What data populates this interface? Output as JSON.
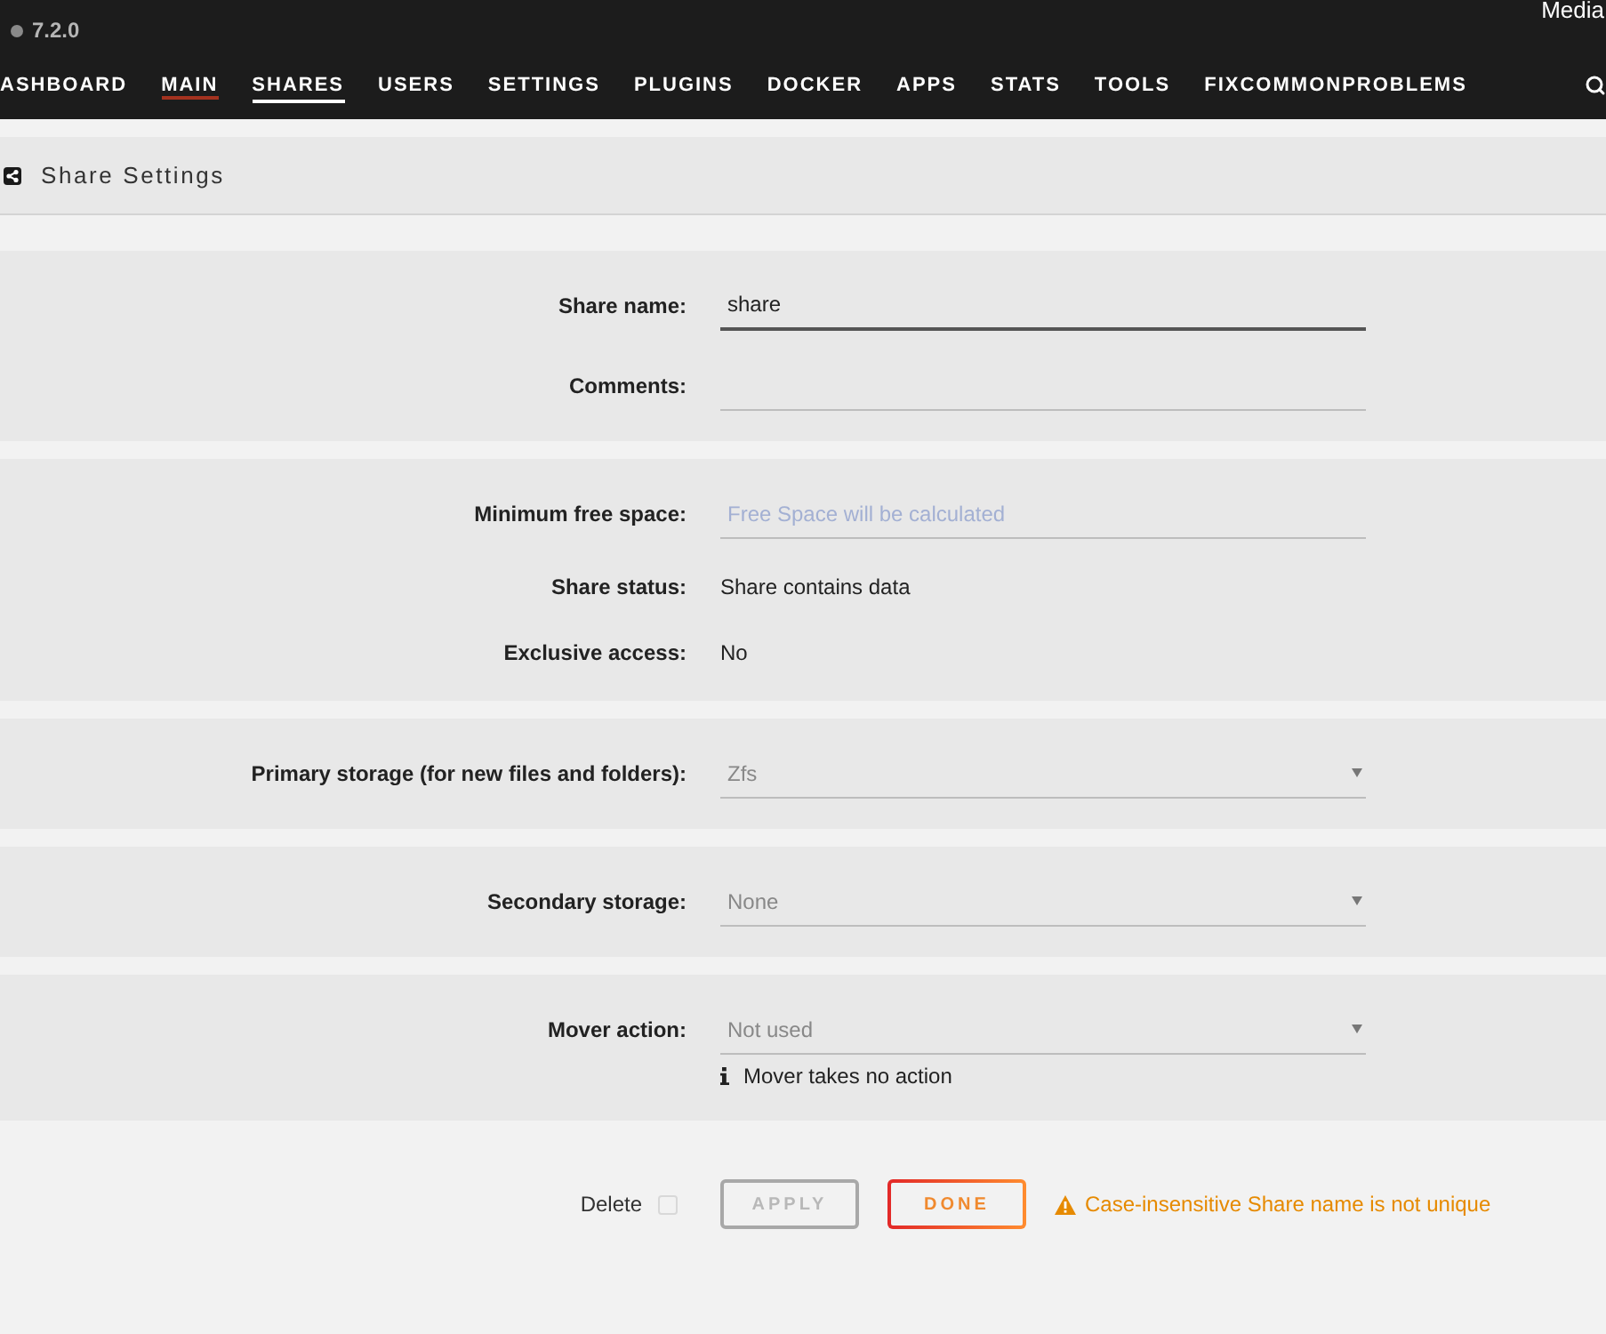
{
  "header": {
    "version": "7.2.0",
    "server_name": "Media"
  },
  "nav": {
    "items": [
      {
        "label": "ASHBOARD",
        "selected": false,
        "highlighted": false
      },
      {
        "label": "MAIN",
        "selected": false,
        "highlighted": true
      },
      {
        "label": "SHARES",
        "selected": true,
        "highlighted": false
      },
      {
        "label": "USERS",
        "selected": false,
        "highlighted": false
      },
      {
        "label": "SETTINGS",
        "selected": false,
        "highlighted": false
      },
      {
        "label": "PLUGINS",
        "selected": false,
        "highlighted": false
      },
      {
        "label": "DOCKER",
        "selected": false,
        "highlighted": false
      },
      {
        "label": "APPS",
        "selected": false,
        "highlighted": false
      },
      {
        "label": "STATS",
        "selected": false,
        "highlighted": false
      },
      {
        "label": "TOOLS",
        "selected": false,
        "highlighted": false
      },
      {
        "label": "FIXCOMMONPROBLEMS",
        "selected": false,
        "highlighted": false
      }
    ]
  },
  "page_title": "Share Settings",
  "sections": [
    {
      "rows": [
        {
          "kind": "input",
          "label": "Share name:",
          "value": "share",
          "focused": true
        },
        {
          "kind": "input",
          "label": "Comments:",
          "focused": false
        }
      ]
    },
    {
      "rows": [
        {
          "kind": "input",
          "label": "Minimum free space:",
          "placeholder": "Free Space will be calculated",
          "focused": false
        },
        {
          "kind": "text",
          "label": "Share status:",
          "value": "Share contains data"
        },
        {
          "kind": "text",
          "label": "Exclusive access:",
          "value": "No"
        }
      ]
    },
    {
      "rows": [
        {
          "kind": "select",
          "label": "Primary storage (for new files and folders):",
          "value": "Zfs",
          "disabled": true
        }
      ]
    },
    {
      "rows": [
        {
          "kind": "select",
          "label": "Secondary storage:",
          "value": "None",
          "disabled": true
        }
      ]
    },
    {
      "rows": [
        {
          "kind": "select",
          "label": "Mover action:",
          "value": "Not used",
          "disabled": true,
          "note": "Mover takes no action"
        }
      ]
    }
  ],
  "footer": {
    "delete": {
      "label": "Delete",
      "checked": false
    },
    "buttons": [
      {
        "label": "APPLY",
        "disabled": true
      },
      {
        "label": "DONE",
        "disabled": false
      }
    ],
    "warning": "Case-insensitive Share name is not unique"
  }
}
